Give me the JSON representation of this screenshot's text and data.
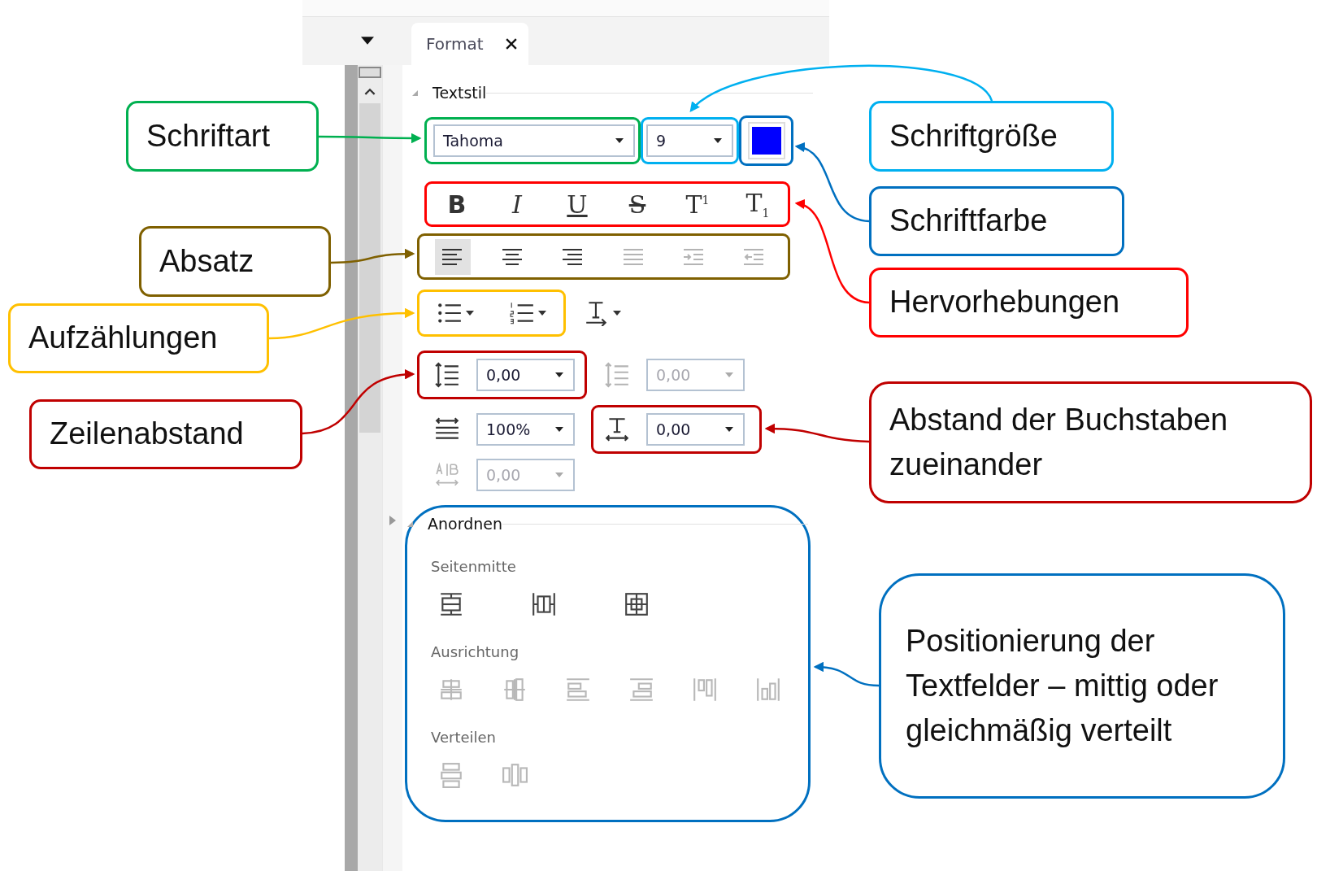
{
  "panel": {
    "tab": {
      "label": "Format",
      "selected": true
    },
    "text_style": {
      "title": "Textstil",
      "font": "Tahoma",
      "size": "9",
      "color": "#0000ff",
      "formatting": [
        {
          "kind": "bold",
          "label": "B"
        },
        {
          "kind": "italic",
          "label": "I"
        },
        {
          "kind": "underline",
          "label": "U"
        },
        {
          "kind": "strike",
          "label": "S"
        },
        {
          "kind": "superscript",
          "label": "T$^{1}$"
        },
        {
          "kind": "subscript",
          "label": "T$_{1}$"
        }
      ],
      "alignment": [
        {
          "kind": "left",
          "selected": true,
          "disabled": false
        },
        {
          "kind": "center",
          "selected": false,
          "disabled": false
        },
        {
          "kind": "right",
          "selected": false,
          "disabled": false
        },
        {
          "kind": "justify",
          "selected": false,
          "disabled": true
        },
        {
          "kind": "indent",
          "selected": false,
          "disabled": true
        },
        {
          "kind": "outdent",
          "selected": false,
          "disabled": true
        }
      ],
      "lists": [
        {
          "kind": "bullets"
        },
        {
          "kind": "numbers"
        }
      ],
      "spacing": [
        {
          "kind": "line-before",
          "value": "0,00",
          "disabled": false
        },
        {
          "kind": "line-after",
          "value": "0,00",
          "disabled": true
        },
        {
          "kind": "scale",
          "value": "100%",
          "disabled": false
        },
        {
          "kind": "char",
          "value": "0,00",
          "disabled": false
        },
        {
          "kind": "kerning",
          "value": "0,00",
          "disabled": true
        }
      ]
    },
    "arrange": {
      "title": "Anordnen",
      "groups": [
        {
          "title": "Seitenmitte",
          "disabled": false,
          "tools": [
            {
              "kind": "center-v"
            },
            {
              "kind": "center-h"
            },
            {
              "kind": "center-both"
            }
          ]
        },
        {
          "title": "Ausrichtung",
          "disabled": true,
          "tools": [
            {
              "kind": "align-middle"
            },
            {
              "kind": "align-center"
            },
            {
              "kind": "align-top"
            },
            {
              "kind": "align-bottom"
            },
            {
              "kind": "align-left"
            },
            {
              "kind": "align-right"
            }
          ]
        },
        {
          "title": "Verteilen",
          "disabled": true,
          "tools": [
            {
              "kind": "dist-v"
            },
            {
              "kind": "dist-h"
            }
          ]
        }
      ]
    }
  },
  "callouts": [
    {
      "kind": "font",
      "text": "Schriftart",
      "color": "#00b050"
    },
    {
      "kind": "alignment",
      "text": "Absatz",
      "color": "#7f6000"
    },
    {
      "kind": "lists",
      "text": "Aufzählungen",
      "color": "#ffc000"
    },
    {
      "kind": "line",
      "text": "Zeilenabstand",
      "color": "#c00000"
    },
    {
      "kind": "size",
      "text": "Schriftgröße",
      "color": "#00b0f0"
    },
    {
      "kind": "color",
      "text": "Schriftfarbe",
      "color": "#0070c0"
    },
    {
      "kind": "formatting",
      "text": "Hervorhebungen",
      "color": "#ff0000"
    },
    {
      "kind": "char",
      "text": "Abstand der Buchstaben zueinander",
      "color": "#c00000"
    },
    {
      "kind": "arrange",
      "text": "Positionierung der Textfelder – mittig oder gleichmäßig verteilt",
      "color": "#0070c0"
    }
  ]
}
